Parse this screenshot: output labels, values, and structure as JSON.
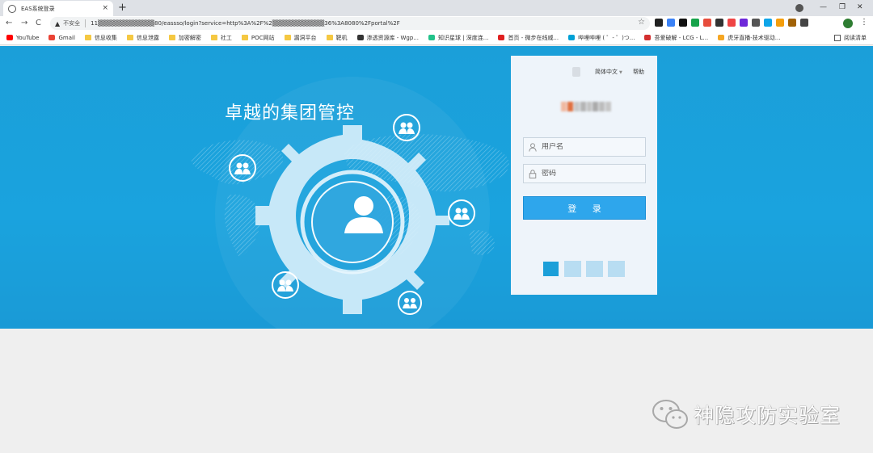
{
  "browser": {
    "tab": {
      "title": "EAS系统登录",
      "close": "×"
    },
    "new_tab": "+",
    "nav": {
      "back": "←",
      "forward": "→",
      "reload": "C"
    },
    "omnibox": {
      "security_label": "不安全",
      "url": "11▒▒▒▒▒▒▒▒▒▒▒▒▒80/eassso/login?service=http%3A%2F%2▒▒▒▒▒▒▒▒▒▒▒▒36%3A8080%2Fportal%2F"
    },
    "window": {
      "minimize": "—",
      "maximize": "❐",
      "close": "✕"
    },
    "bookmarks": [
      {
        "label": "YouTube",
        "icon": "youtube-icon",
        "color": "#ff0000"
      },
      {
        "label": "Gmail",
        "icon": "gmail-icon",
        "color": "#ea4335"
      },
      {
        "label": "信息收集",
        "icon": "folder-icon",
        "color": "#f5c842"
      },
      {
        "label": "信息泄露",
        "icon": "folder-icon",
        "color": "#f5c842"
      },
      {
        "label": "加密解密",
        "icon": "folder-icon",
        "color": "#f5c842"
      },
      {
        "label": "社工",
        "icon": "folder-icon",
        "color": "#f5c842"
      },
      {
        "label": "POC网站",
        "icon": "folder-icon",
        "color": "#f5c842"
      },
      {
        "label": "漏洞平台",
        "icon": "folder-icon",
        "color": "#f5c842"
      },
      {
        "label": "靶机",
        "icon": "folder-icon",
        "color": "#f5c842"
      },
      {
        "label": "渗透资源库 - Wgp...",
        "icon": "github-icon",
        "color": "#333333"
      },
      {
        "label": "知识星球 | 深度连...",
        "icon": "planet-icon",
        "color": "#22c28a"
      },
      {
        "label": "首页 - 微步在线威...",
        "icon": "x-icon",
        "color": "#e02020"
      },
      {
        "label": "哔哩哔哩 ( ゜- ゜)つ...",
        "icon": "bilibili-icon",
        "color": "#00a1d6"
      },
      {
        "label": "吾爱破解 - LCG - L...",
        "icon": "pojie-icon",
        "color": "#d32f2f"
      },
      {
        "label": "虎牙直播-技术驱动...",
        "icon": "huya-icon",
        "color": "#f5a623"
      }
    ],
    "reading_list": "阅读清单",
    "extensions": [
      "#222222",
      "#3b82f6",
      "#111111",
      "#16a34a",
      "#e74c3c",
      "#333333",
      "#ef4444",
      "#6d28d9",
      "#555555",
      "#0ea5e9",
      "#f59e0b",
      "#a16207",
      "#444444"
    ],
    "profile_initial": ""
  },
  "page": {
    "slogan": "卓越的集团管控",
    "login": {
      "language": "简体中文",
      "help": "帮助",
      "username_placeholder": "用户名",
      "password_placeholder": "密码",
      "login_button": "登 录"
    },
    "colors": {
      "hero_bg": "#1b9fd9",
      "panel_bg": "#eef4fa",
      "button": "#2ea6ec"
    },
    "skins": [
      {
        "name": "skin-blue-dark",
        "color": "#1b9fd9"
      },
      {
        "name": "skin-blue-light-1",
        "color": "#b8ddf2"
      },
      {
        "name": "skin-blue-light-2",
        "color": "#b8ddf2"
      },
      {
        "name": "skin-blue-light-3",
        "color": "#b8ddf2"
      }
    ]
  },
  "watermark": {
    "text": "神隐攻防实验室",
    "icon": "wechat-icon"
  }
}
